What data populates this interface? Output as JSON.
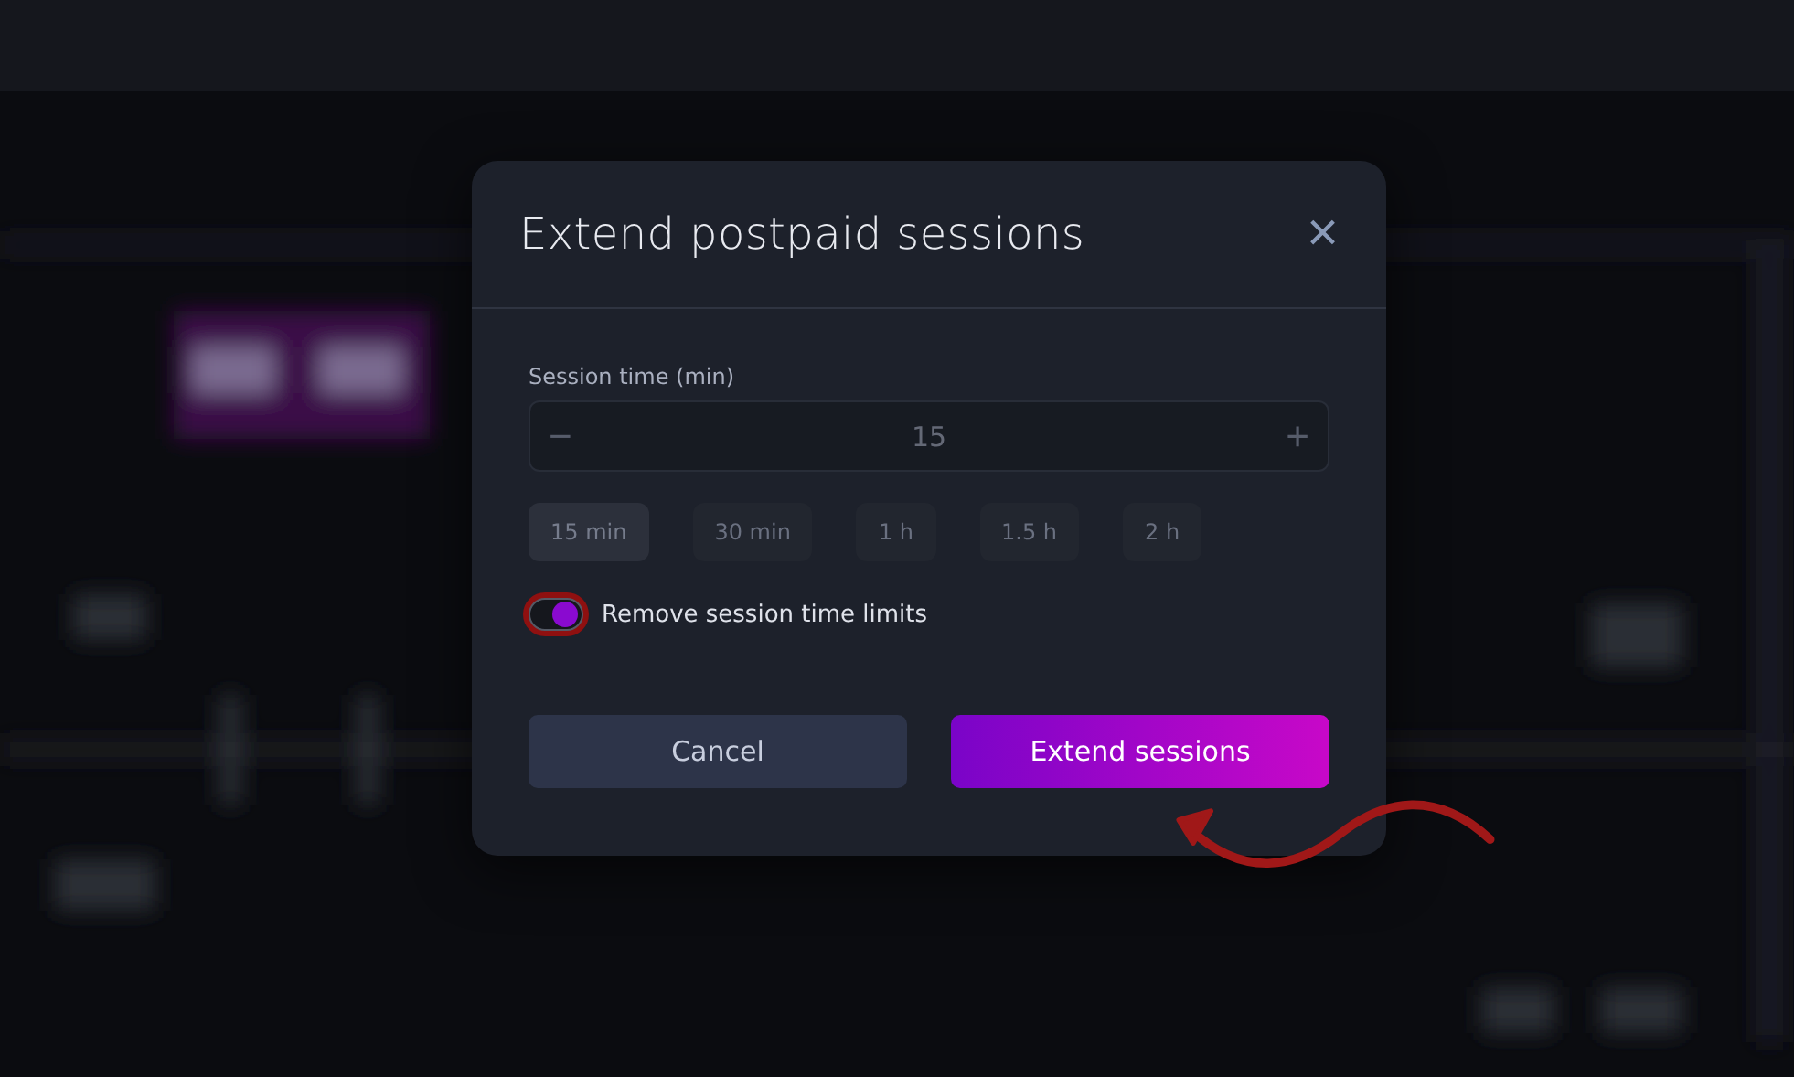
{
  "dialog": {
    "title": "Extend postpaid sessions",
    "close_icon": "×"
  },
  "session_time": {
    "label": "Session time (min)",
    "value": "15",
    "decrement": "−",
    "increment": "+",
    "disabled": true
  },
  "presets": {
    "disabled": true,
    "items": [
      {
        "label": "15 min",
        "selected": true
      },
      {
        "label": "30 min",
        "selected": false
      },
      {
        "label": "1 h",
        "selected": false
      },
      {
        "label": "1.5 h",
        "selected": false
      },
      {
        "label": "2 h",
        "selected": false
      }
    ]
  },
  "toggle": {
    "label": "Remove session time limits",
    "on": true,
    "highlighted": true
  },
  "buttons": [
    {
      "label": "Cancel",
      "kind": "secondary"
    },
    {
      "label": "Extend sessions",
      "kind": "primary"
    }
  ],
  "annotation": {
    "kind": "arrow"
  }
}
